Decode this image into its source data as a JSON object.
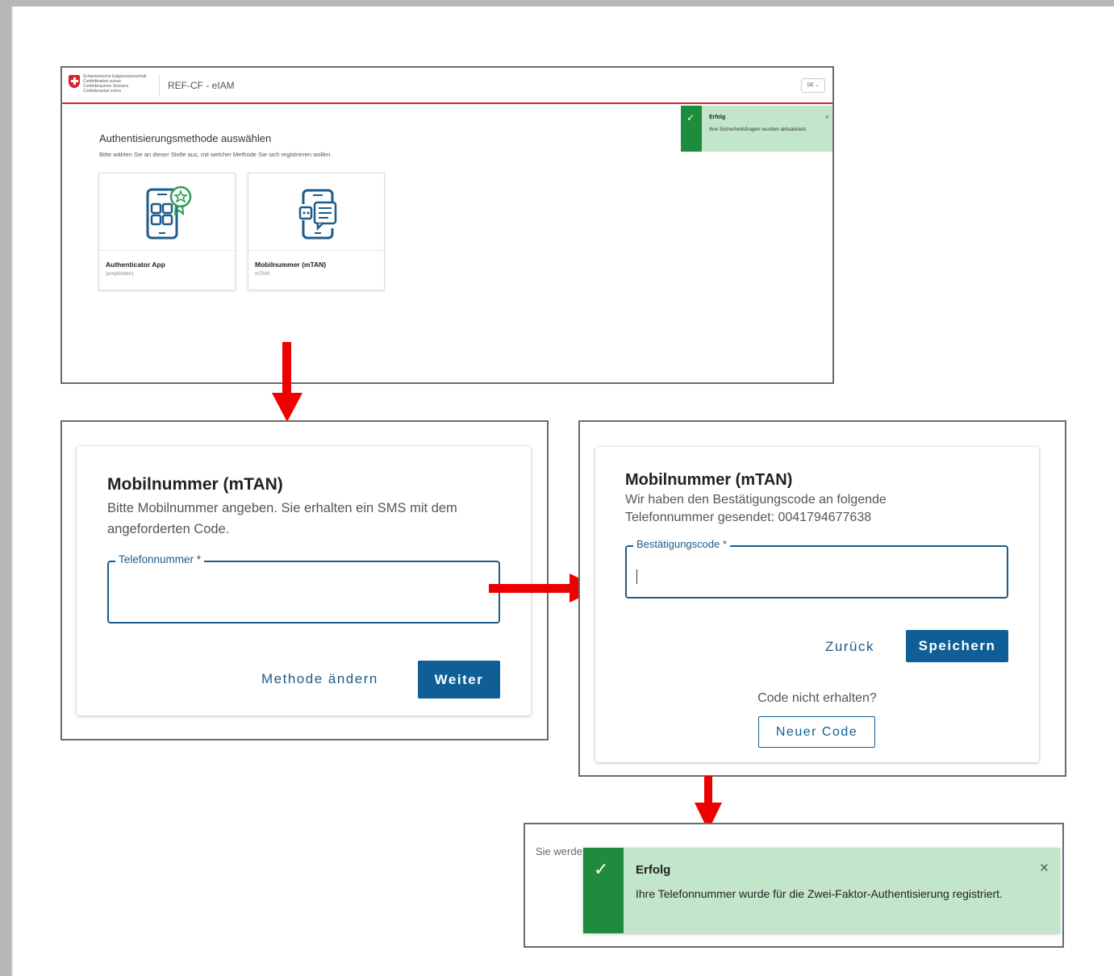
{
  "step1": {
    "header": {
      "confederation_lines": [
        "Schweizerische Eidgenossenschaft",
        "Confédération suisse",
        "Confederazione Svizzera",
        "Confederaziun svizra"
      ],
      "app_title": "REF-CF - eIAM",
      "language": "DE"
    },
    "title": "Authentisierungsmethode auswählen",
    "subtitle": "Bitte wählen Sie an dieser Stelle aus, mit welcher Methode Sie sich registrieren wollen.",
    "methods": [
      {
        "title": "Authenticator App",
        "subtitle": "(empfohlen)",
        "icon": "authenticator-app-icon"
      },
      {
        "title": "Mobilnummer (mTAN)",
        "subtitle": "mTAN",
        "icon": "mobile-sms-icon"
      }
    ],
    "toast": {
      "title": "Erfolg",
      "message": "Ihre Sicherheitsfragen wurden aktualisiert.",
      "close": "×",
      "icon": "check-icon"
    }
  },
  "step2": {
    "title": "Mobilnummer (mTAN)",
    "description": "Bitte Mobilnummer angeben. Sie erhalten ein SMS mit dem angeforderten Code.",
    "phone_label": "Telefonnummer *",
    "phone_value": "",
    "change_method_label": "Methode ändern",
    "next_label": "Weiter"
  },
  "step3": {
    "title": "Mobilnummer (mTAN)",
    "description": "Wir haben den Bestätigungscode an folgende Telefonnummer gesendet: 0041794677638",
    "code_label": "Bestätigungscode *",
    "code_value": "",
    "back_label": "Zurück",
    "save_label": "Speichern",
    "not_received": "Code nicht erhalten?",
    "new_code_label": "Neuer Code"
  },
  "step4": {
    "background_text": "Sie werde",
    "toast": {
      "title": "Erfolg",
      "message": "Ihre Telefonnummer wurde für die Zwei-Faktor-Authentisierung registriert.",
      "close": "×",
      "icon": "check-icon"
    }
  },
  "colors": {
    "accent": "#0f5f96",
    "arrow": "#ee0000",
    "success_bar": "#1f8b3c",
    "success_bg": "#c3e6cb",
    "swiss_red": "#d8232a"
  }
}
